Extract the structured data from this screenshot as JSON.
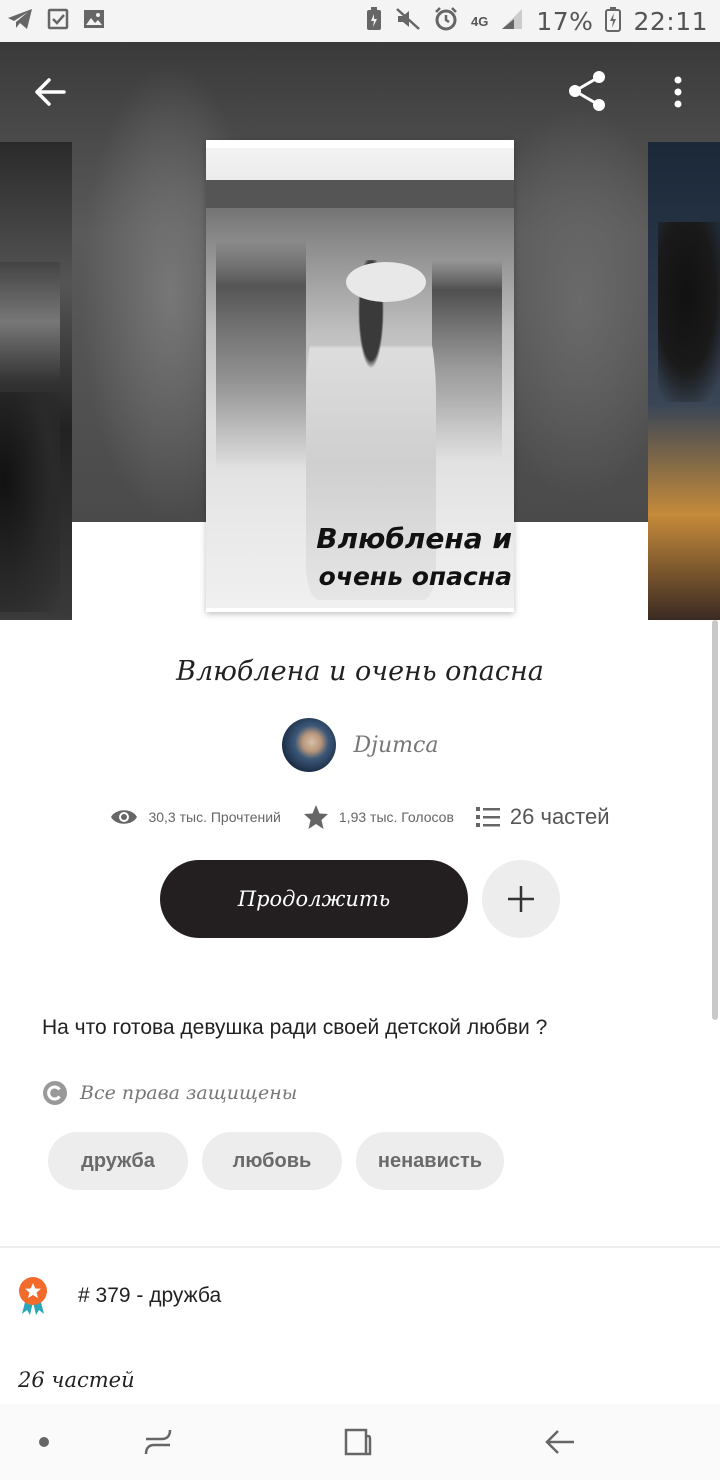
{
  "status_bar": {
    "network": "4G",
    "battery": "17%",
    "time": "22:11"
  },
  "header": {
    "back_icon": "arrow-left-icon",
    "share_icon": "share-icon",
    "more_icon": "more-vertical-icon"
  },
  "cover": {
    "line1": "Влюблена и",
    "line2": "очень опасна"
  },
  "story": {
    "title": "Влюблена и очень опасна",
    "author": "Djumca",
    "reads": "30,3 тыс. Прочтений",
    "votes": "1,93 тыс. Голосов",
    "parts": "26 частей",
    "continue_label": "Продолжить",
    "description": "На что готова девушка ради своей детской любви ?",
    "rights": "Все права защищены",
    "tags": [
      "дружба",
      "любовь",
      "ненависть"
    ],
    "rank": "# 379 - дружба",
    "parts_heading": "26 частей"
  },
  "colors": {
    "primary_button": "#231f20",
    "secondary_button": "#ededed",
    "tag_bg": "#ededed",
    "rank_badge": "#f26b2b"
  }
}
